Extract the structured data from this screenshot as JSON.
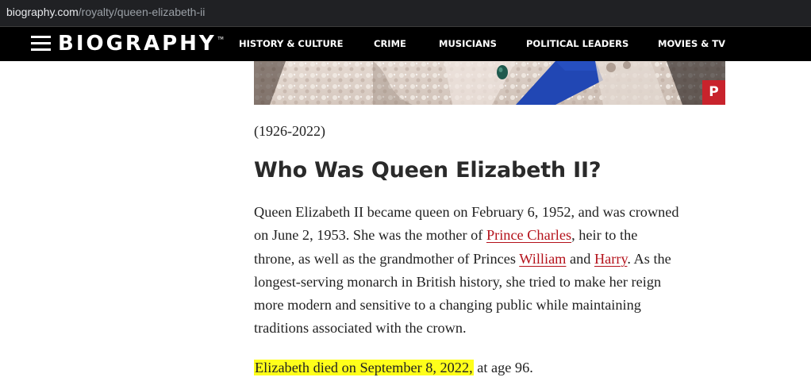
{
  "browser": {
    "url_domain": "biography.com",
    "url_path": "/royalty/queen-elizabeth-ii"
  },
  "header": {
    "logo": "BIOGRAPHY",
    "logo_tm": "TM",
    "nav": [
      {
        "label": "HISTORY & CULTURE"
      },
      {
        "label": "CRIME"
      },
      {
        "label": "MUSICIANS"
      },
      {
        "label": "POLITICAL LEADERS"
      },
      {
        "label": "MOVIES & TV"
      }
    ]
  },
  "hero": {
    "pinterest_glyph": "P",
    "pinterest_icon": "pinterest-icon"
  },
  "article": {
    "years": "(1926-2022)",
    "heading": "Who Was Queen Elizabeth II?",
    "paragraph1": {
      "line1": "Queen Elizabeth II became queen on February 6, 1952, and was crowned",
      "line2_pre": "on June 2, 1953. She was the mother of ",
      "link_charles": "Prince Charles",
      "line2_post": ", heir to the",
      "line3_pre": "throne, as well as the grandmother of Princes ",
      "link_william": "William",
      "line3_mid": " and ",
      "link_harry": "Harry",
      "line3_post": ". As the",
      "line4": "longest-serving monarch in British history, she tried to make her reign",
      "line5": "more modern and sensitive to a changing public while maintaining",
      "line6": "traditions associated with the crown."
    },
    "paragraph2": {
      "highlighted": "Elizabeth died on September 8, 2022,",
      "rest": " at age 96."
    }
  },
  "colors": {
    "link": "#b4121b",
    "highlight": "#ffff1a",
    "header_bg": "#000000",
    "pinterest": "#c8232c"
  }
}
